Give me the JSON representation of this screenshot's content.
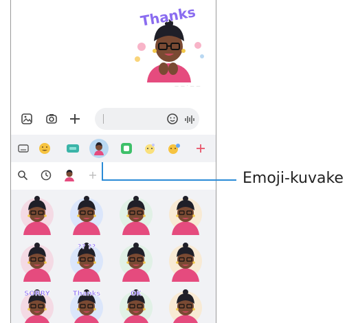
{
  "chat": {
    "sticker_text": "Thanks",
    "timestamp": "— —  ·  — —"
  },
  "tray": {
    "icons": [
      "keyboard-icon",
      "emoji-face-icon",
      "gif-icon",
      "avatar-emoji-icon",
      "sticker-icon",
      "bitmoji-icon",
      "mojitok-icon",
      "add-icon"
    ],
    "accent": "#e8556b",
    "selected_bg": "#b9d8f2"
  },
  "grid": {
    "stickers": [
      {
        "caption": ""
      },
      {
        "caption": ""
      },
      {
        "caption": ""
      },
      {
        "caption": ""
      },
      {
        "caption": ""
      },
      {
        "caption": "?? ??"
      },
      {
        "caption": ""
      },
      {
        "caption": ""
      },
      {
        "caption": "SORRY"
      },
      {
        "caption": "Thanks"
      },
      {
        "caption": "OK"
      },
      {
        "caption": ""
      }
    ]
  },
  "callout": {
    "label": "Emoji-kuvake",
    "line_color": "#2a8bd6"
  }
}
